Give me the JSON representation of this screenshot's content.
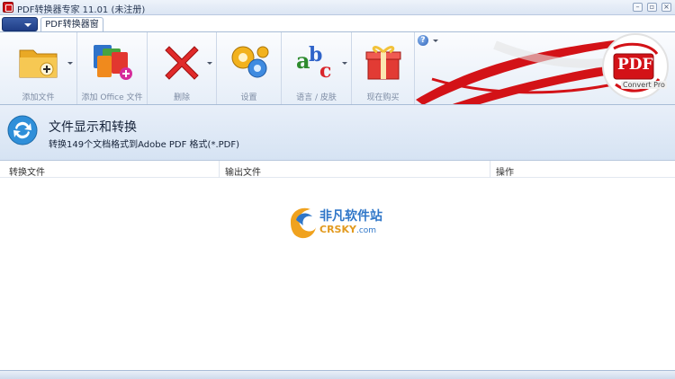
{
  "window": {
    "title": "PDF转换器专家 11.01 (未注册)",
    "controls": [
      "–",
      "▫",
      "×"
    ]
  },
  "tabs": [
    {
      "label": "PDF转换器窗口"
    }
  ],
  "ribbon": {
    "buttons": [
      {
        "label": "添加文件",
        "icon": "add-folder-icon",
        "dropdown": true
      },
      {
        "label": "添加 Office 文件",
        "icon": "office-files-icon",
        "dropdown": false
      },
      {
        "label": "删除",
        "icon": "delete-x-icon",
        "dropdown": true
      },
      {
        "label": "设置",
        "icon": "gears-icon",
        "dropdown": false
      },
      {
        "label": "语言 / 皮肤",
        "icon": "abc-icon",
        "dropdown": true
      },
      {
        "label": "现在购买",
        "icon": "gift-icon",
        "dropdown": false
      }
    ],
    "logo": {
      "text": "PDF",
      "caption": "Convert Pro"
    },
    "help_icon": "?"
  },
  "header": {
    "title": "文件显示和转换",
    "subtitle": "转换149个文档格式到Adobe PDF 格式(*.PDF)"
  },
  "table": {
    "columns": [
      "转换文件",
      "输出文件",
      "操作"
    ]
  },
  "watermark": {
    "cn": "非凡软件站",
    "en_main": "CRSKY",
    "en_suffix": ".com"
  },
  "colors": {
    "accent": "#d0141a",
    "ribbon_bg": "#e6eef8",
    "header_bg": "#dbe6f4"
  }
}
